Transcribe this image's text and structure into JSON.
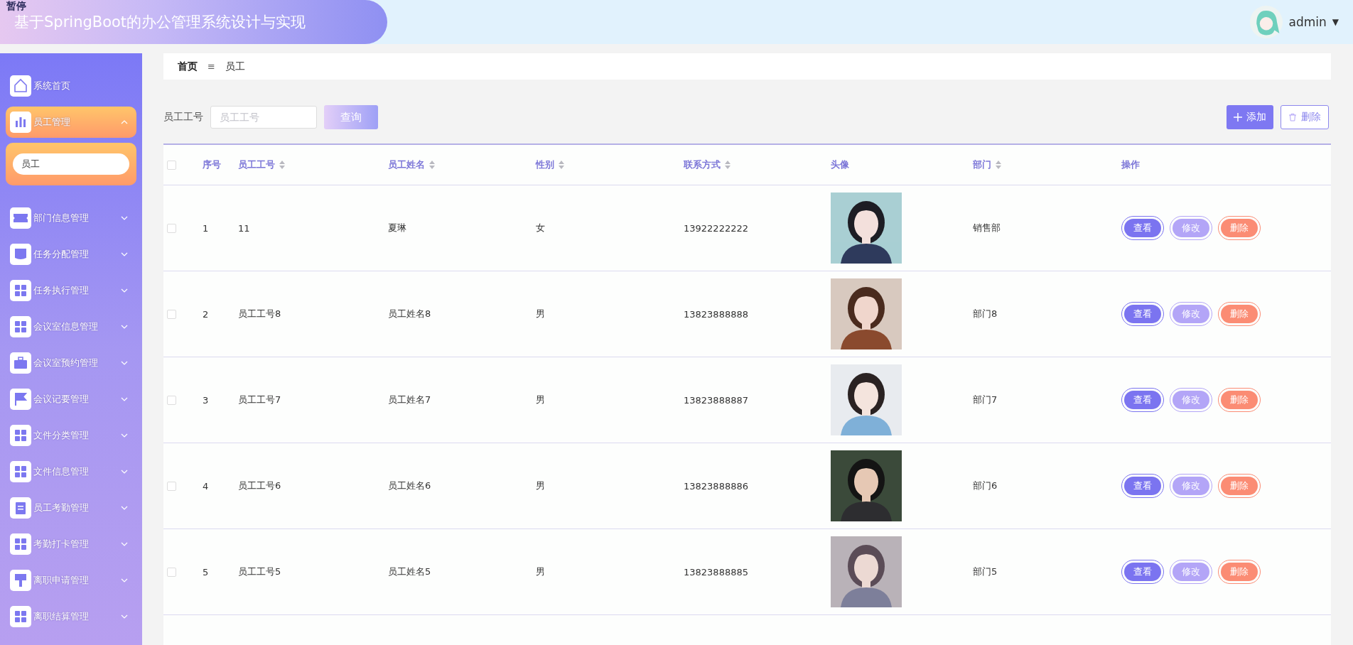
{
  "header": {
    "title": "基于SpringBoot的办公管理系统设计与实现",
    "overlay_label": "暂停",
    "user": {
      "name": "admin",
      "caret": "▼"
    }
  },
  "sidebar": {
    "items": [
      {
        "label": "系统首页",
        "kind": "link"
      },
      {
        "label": "员工管理",
        "kind": "menu",
        "expanded": true,
        "children": [
          {
            "label": "员工",
            "selected": true
          }
        ]
      },
      {
        "label": "部门信息管理",
        "kind": "menu",
        "expanded": false
      },
      {
        "label": "任务分配管理",
        "kind": "menu",
        "expanded": false
      },
      {
        "label": "任务执行管理",
        "kind": "menu",
        "expanded": false
      },
      {
        "label": "会议室信息管理",
        "kind": "menu",
        "expanded": false
      },
      {
        "label": "会议室预约管理",
        "kind": "menu",
        "expanded": false
      },
      {
        "label": "会议记要管理",
        "kind": "menu",
        "expanded": false
      },
      {
        "label": "文件分类管理",
        "kind": "menu",
        "expanded": false
      },
      {
        "label": "文件信息管理",
        "kind": "menu",
        "expanded": false
      },
      {
        "label": "员工考勤管理",
        "kind": "menu",
        "expanded": false
      },
      {
        "label": "考勤打卡管理",
        "kind": "menu",
        "expanded": false
      },
      {
        "label": "离职申请管理",
        "kind": "menu",
        "expanded": false
      },
      {
        "label": "离职结算管理",
        "kind": "menu",
        "expanded": false
      }
    ]
  },
  "breadcrumb": {
    "items": [
      "首页",
      "员工"
    ],
    "separator": "≡"
  },
  "search": {
    "label": "员工工号",
    "placeholder": "员工工号",
    "button": "查询"
  },
  "actions": {
    "add": "添加",
    "delete": "删除"
  },
  "table": {
    "header_checked": false,
    "columns": [
      {
        "label": "序号",
        "sortable": false
      },
      {
        "label": "员工工号",
        "sortable": true
      },
      {
        "label": "员工姓名",
        "sortable": true
      },
      {
        "label": "性别",
        "sortable": true
      },
      {
        "label": "联系方式",
        "sortable": true
      },
      {
        "label": "头像",
        "sortable": false
      },
      {
        "label": "部门",
        "sortable": true
      },
      {
        "label": "操作",
        "sortable": false
      }
    ],
    "rows": [
      {
        "checked": false,
        "index": "1",
        "id": "11",
        "name": "夏琳",
        "gender": "女",
        "phone": "13922222222",
        "department": "销售部",
        "buttons": [
          {
            "label": "查看",
            "kind": "view"
          },
          {
            "label": "修改",
            "kind": "edit"
          },
          {
            "label": "删除",
            "kind": "delete"
          }
        ]
      },
      {
        "checked": false,
        "index": "2",
        "id": "员工工号8",
        "name": "员工姓名8",
        "gender": "男",
        "phone": "13823888888",
        "department": "部门8",
        "buttons": [
          {
            "label": "查看",
            "kind": "view"
          },
          {
            "label": "修改",
            "kind": "edit"
          },
          {
            "label": "删除",
            "kind": "delete"
          }
        ]
      },
      {
        "checked": false,
        "index": "3",
        "id": "员工工号7",
        "name": "员工姓名7",
        "gender": "男",
        "phone": "13823888887",
        "department": "部门7",
        "buttons": [
          {
            "label": "查看",
            "kind": "view"
          },
          {
            "label": "修改",
            "kind": "edit"
          },
          {
            "label": "删除",
            "kind": "delete"
          }
        ]
      },
      {
        "checked": false,
        "index": "4",
        "id": "员工工号6",
        "name": "员工姓名6",
        "gender": "男",
        "phone": "13823888886",
        "department": "部门6",
        "buttons": [
          {
            "label": "查看",
            "kind": "view"
          },
          {
            "label": "修改",
            "kind": "edit"
          },
          {
            "label": "删除",
            "kind": "delete"
          }
        ]
      },
      {
        "checked": false,
        "index": "5",
        "id": "员工工号5",
        "name": "员工姓名5",
        "gender": "男",
        "phone": "13823888885",
        "department": "部门5",
        "buttons": [
          {
            "label": "查看",
            "kind": "view"
          },
          {
            "label": "修改",
            "kind": "edit"
          },
          {
            "label": "删除",
            "kind": "delete"
          }
        ]
      }
    ]
  }
}
